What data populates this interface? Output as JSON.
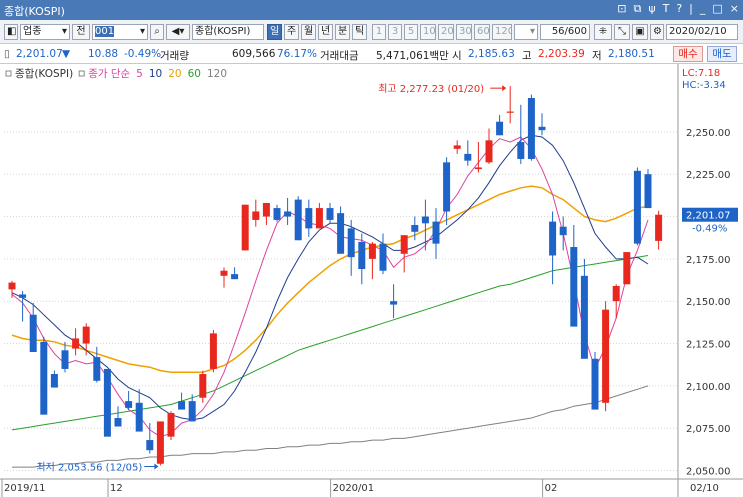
{
  "window": {
    "title": "종합(KOSPI)",
    "controls": [
      "⊡",
      "⧉",
      "ψ",
      "T",
      "?",
      "|",
      "_",
      "□",
      "×"
    ]
  },
  "toolbar": {
    "market": "업종",
    "jeon": "전",
    "code": "001",
    "search_icon": "search-icon",
    "sound": "◀▾",
    "name": "종합(KOSPI)",
    "periods": [
      "일",
      "주",
      "월",
      "년",
      "분",
      "틱"
    ],
    "active_period": "일",
    "minute_units": [
      "1",
      "3",
      "5",
      "10",
      "20",
      "30",
      "60",
      "120"
    ],
    "count_value": "56/600",
    "date": "2020/02/10"
  },
  "quote": {
    "price": "2,201.07",
    "change_arrow": "▼",
    "change": "10.88",
    "change_pct": "-0.49%",
    "volume_label": "거래량",
    "volume": "609,566",
    "volume_ratio": "76.17%",
    "amount_label": "거래대금",
    "amount": "5,471,061백만",
    "open_label": "시",
    "open": "2,185.63",
    "high_label": "고",
    "high": "2,203.39",
    "low_label": "저",
    "low": "2,180.51",
    "buy_label": "매수",
    "sell_label": "매도"
  },
  "chart_data": {
    "type": "candlestick",
    "legend": [
      "종합(KOSPI)",
      "종가 단순",
      "5",
      "10",
      "20",
      "60",
      "120"
    ],
    "colors": {
      "up": "#e8281e",
      "down": "#1e64c8",
      "ma5": "#e040a0",
      "ma10": "#1e3c8c",
      "ma20": "#f0a000",
      "ma60": "#28a028",
      "ma120": "#808080",
      "axis": "#505050",
      "grid": "#d8d8d8"
    },
    "y_ticks": [
      "2,050.00",
      "2,075.00",
      "2,100.00",
      "2,125.00",
      "2,150.00",
      "2,175.00",
      "2,200.00",
      "2,225.00",
      "2,250.00"
    ],
    "y_tick_values": [
      2050,
      2075,
      2100,
      2125,
      2150,
      2175,
      2200,
      2225,
      2250
    ],
    "ylim": [
      2045,
      2283
    ],
    "x_labels": [
      "2019/11",
      "12",
      "2020/01",
      "02",
      "02/10"
    ],
    "x_label_index": [
      0,
      10,
      31,
      51,
      55
    ],
    "lc_label": "LC:7.18",
    "hc_label": "HC:-3.34",
    "current_price": "2,201.07",
    "current_pct": "-0.49%",
    "current_value": 2201.07,
    "annotation_high": "최고 2,277.23 (01/20)",
    "annotation_low": "최저 2,053.56 (12/05)",
    "candles": [
      [
        2157,
        2162,
        2152,
        2161
      ],
      [
        2154,
        2156,
        2138,
        2152
      ],
      [
        2142,
        2149,
        2122,
        2120
      ],
      [
        2126,
        2129,
        2088,
        2083
      ],
      [
        2107,
        2109,
        2100,
        2099
      ],
      [
        2121,
        2126,
        2108,
        2110
      ],
      [
        2122,
        2134,
        2118,
        2128
      ],
      [
        2125,
        2137,
        2118,
        2135
      ],
      [
        2117,
        2123,
        2102,
        2103
      ],
      [
        2110,
        2110,
        2087,
        2070
      ],
      [
        2081,
        2088,
        2077,
        2076
      ],
      [
        2091,
        2097,
        2086,
        2087
      ],
      [
        2090,
        2098,
        2074,
        2073
      ],
      [
        2068,
        2078,
        2060,
        2062
      ],
      [
        2054,
        2079,
        2053,
        2079
      ],
      [
        2070,
        2085,
        2068,
        2084
      ],
      [
        2091,
        2096,
        2088,
        2086
      ],
      [
        2091,
        2095,
        2079,
        2079
      ],
      [
        2093,
        2109,
        2090,
        2107
      ],
      [
        2110,
        2133,
        2108,
        2131
      ],
      [
        2165,
        2170,
        2158,
        2168
      ],
      [
        2166,
        2170,
        2164,
        2163
      ],
      [
        2180,
        2207,
        2180,
        2207
      ],
      [
        2198,
        2210,
        2194,
        2203
      ],
      [
        2200,
        2204,
        2195,
        2208
      ],
      [
        2205,
        2207,
        2197,
        2198
      ],
      [
        2203,
        2211,
        2195,
        2200
      ],
      [
        2210,
        2212,
        2186,
        2186
      ],
      [
        2205,
        2210,
        2188,
        2193
      ],
      [
        2193,
        2208,
        2193,
        2205
      ],
      [
        2205,
        2208,
        2196,
        2198
      ],
      [
        2202,
        2206,
        2180,
        2178
      ],
      [
        2193,
        2198,
        2165,
        2176
      ],
      [
        2185,
        2190,
        2160,
        2169
      ],
      [
        2175,
        2185,
        2163,
        2184
      ],
      [
        2184,
        2190,
        2166,
        2168
      ],
      [
        2150,
        2160,
        2140,
        2148
      ],
      [
        2178,
        2189,
        2167,
        2189
      ],
      [
        2195,
        2200,
        2186,
        2191
      ],
      [
        2200,
        2210,
        2180,
        2196
      ],
      [
        2197,
        2205,
        2175,
        2184
      ],
      [
        2232,
        2235,
        2195,
        2203
      ],
      [
        2240,
        2245,
        2237,
        2242
      ],
      [
        2237,
        2245,
        2230,
        2233
      ],
      [
        2228,
        2244,
        2226,
        2229
      ],
      [
        2232,
        2252,
        2231,
        2245
      ],
      [
        2256,
        2260,
        2248,
        2248
      ],
      [
        2262,
        2277,
        2255,
        2262
      ],
      [
        2244,
        2266,
        2231,
        2234
      ],
      [
        2270,
        2272,
        2233,
        2234
      ],
      [
        2253,
        2261,
        2248,
        2251
      ],
      [
        2197,
        2203,
        2160,
        2177
      ],
      [
        2194,
        2200,
        2180,
        2189
      ],
      [
        2182,
        2195,
        2164,
        2135
      ],
      [
        2165,
        2175,
        2120,
        2116
      ],
      [
        2116,
        2120,
        2086,
        2086
      ],
      [
        2090,
        2150,
        2085,
        2145
      ],
      [
        2150,
        2160,
        2140,
        2159
      ],
      [
        2160,
        2179,
        2160,
        2179
      ],
      [
        2227,
        2229,
        2183,
        2184
      ],
      [
        2225,
        2228,
        2205,
        2205
      ],
      [
        2185.63,
        2203.39,
        2180.51,
        2201.07
      ]
    ],
    "ma5": [
      2154,
      2149,
      2140,
      2128,
      2119,
      2113,
      2115,
      2113,
      2114,
      2105,
      2095,
      2086,
      2082,
      2074,
      2070,
      2072,
      2078,
      2080,
      2086,
      2095,
      2108,
      2125,
      2143,
      2162,
      2180,
      2196,
      2203,
      2200,
      2196,
      2195,
      2193,
      2188,
      2187,
      2186,
      2183,
      2180,
      2170,
      2176,
      2178,
      2183,
      2192,
      2205,
      2213,
      2224,
      2232,
      2240,
      2246,
      2244,
      2247,
      2240,
      2228,
      2213,
      2190,
      2162,
      2130,
      2110,
      2123,
      2140,
      2165,
      2180,
      2198
    ],
    "ma10": [
      2155,
      2152,
      2148,
      2142,
      2136,
      2130,
      2126,
      2121,
      2116,
      2111,
      2104,
      2099,
      2096,
      2093,
      2087,
      2083,
      2081,
      2080,
      2081,
      2085,
      2089,
      2097,
      2108,
      2120,
      2134,
      2150,
      2164,
      2175,
      2185,
      2192,
      2196,
      2196,
      2194,
      2191,
      2188,
      2184,
      2180,
      2180,
      2182,
      2185,
      2188,
      2193,
      2198,
      2204,
      2211,
      2220,
      2230,
      2238,
      2245,
      2248,
      2247,
      2242,
      2233,
      2220,
      2205,
      2190,
      2182,
      2175,
      2175,
      2176,
      2172
    ],
    "ma20": [
      2130,
      2128,
      2127,
      2127,
      2126,
      2124,
      2123,
      2121,
      2119,
      2117,
      2115,
      2113,
      2112,
      2111,
      2109,
      2108,
      2108,
      2108,
      2108,
      2110,
      2112,
      2116,
      2121,
      2127,
      2134,
      2142,
      2149,
      2155,
      2161,
      2166,
      2171,
      2175,
      2178,
      2180,
      2182,
      2183,
      2184,
      2187,
      2189,
      2192,
      2195,
      2198,
      2201,
      2204,
      2207,
      2210,
      2213,
      2215,
      2217,
      2218,
      2217,
      2213,
      2210,
      2205,
      2200,
      2198,
      2197,
      2199,
      2202,
      2205,
      2206
    ],
    "ma60": [
      2074,
      2075,
      2076,
      2077,
      2078,
      2079,
      2080,
      2081,
      2082,
      2083,
      2084,
      2085,
      2086,
      2087,
      2088,
      2089,
      2091,
      2093,
      2095,
      2097,
      2100,
      2103,
      2106,
      2109,
      2112,
      2115,
      2118,
      2121,
      2123,
      2125,
      2127,
      2129,
      2131,
      2133,
      2135,
      2137,
      2139,
      2141,
      2143,
      2145,
      2147,
      2149,
      2151,
      2153,
      2155,
      2157,
      2159,
      2160,
      2162,
      2164,
      2166,
      2168,
      2169,
      2170,
      2171,
      2172,
      2173,
      2174,
      2175,
      2176,
      2177
    ],
    "ma120": [
      2052,
      2052,
      2052,
      2053,
      2053,
      2054,
      2054,
      2055,
      2055,
      2056,
      2056,
      2057,
      2057,
      2058,
      2058,
      2059,
      2059,
      2060,
      2060,
      2060,
      2061,
      2061,
      2062,
      2062,
      2063,
      2063,
      2064,
      2064,
      2065,
      2065,
      2066,
      2066,
      2067,
      2067,
      2068,
      2068,
      2069,
      2069,
      2070,
      2071,
      2072,
      2073,
      2074,
      2075,
      2076,
      2077,
      2078,
      2079,
      2080,
      2081,
      2083,
      2085,
      2086,
      2088,
      2089,
      2090,
      2092,
      2094,
      2096,
      2098,
      2100
    ]
  }
}
